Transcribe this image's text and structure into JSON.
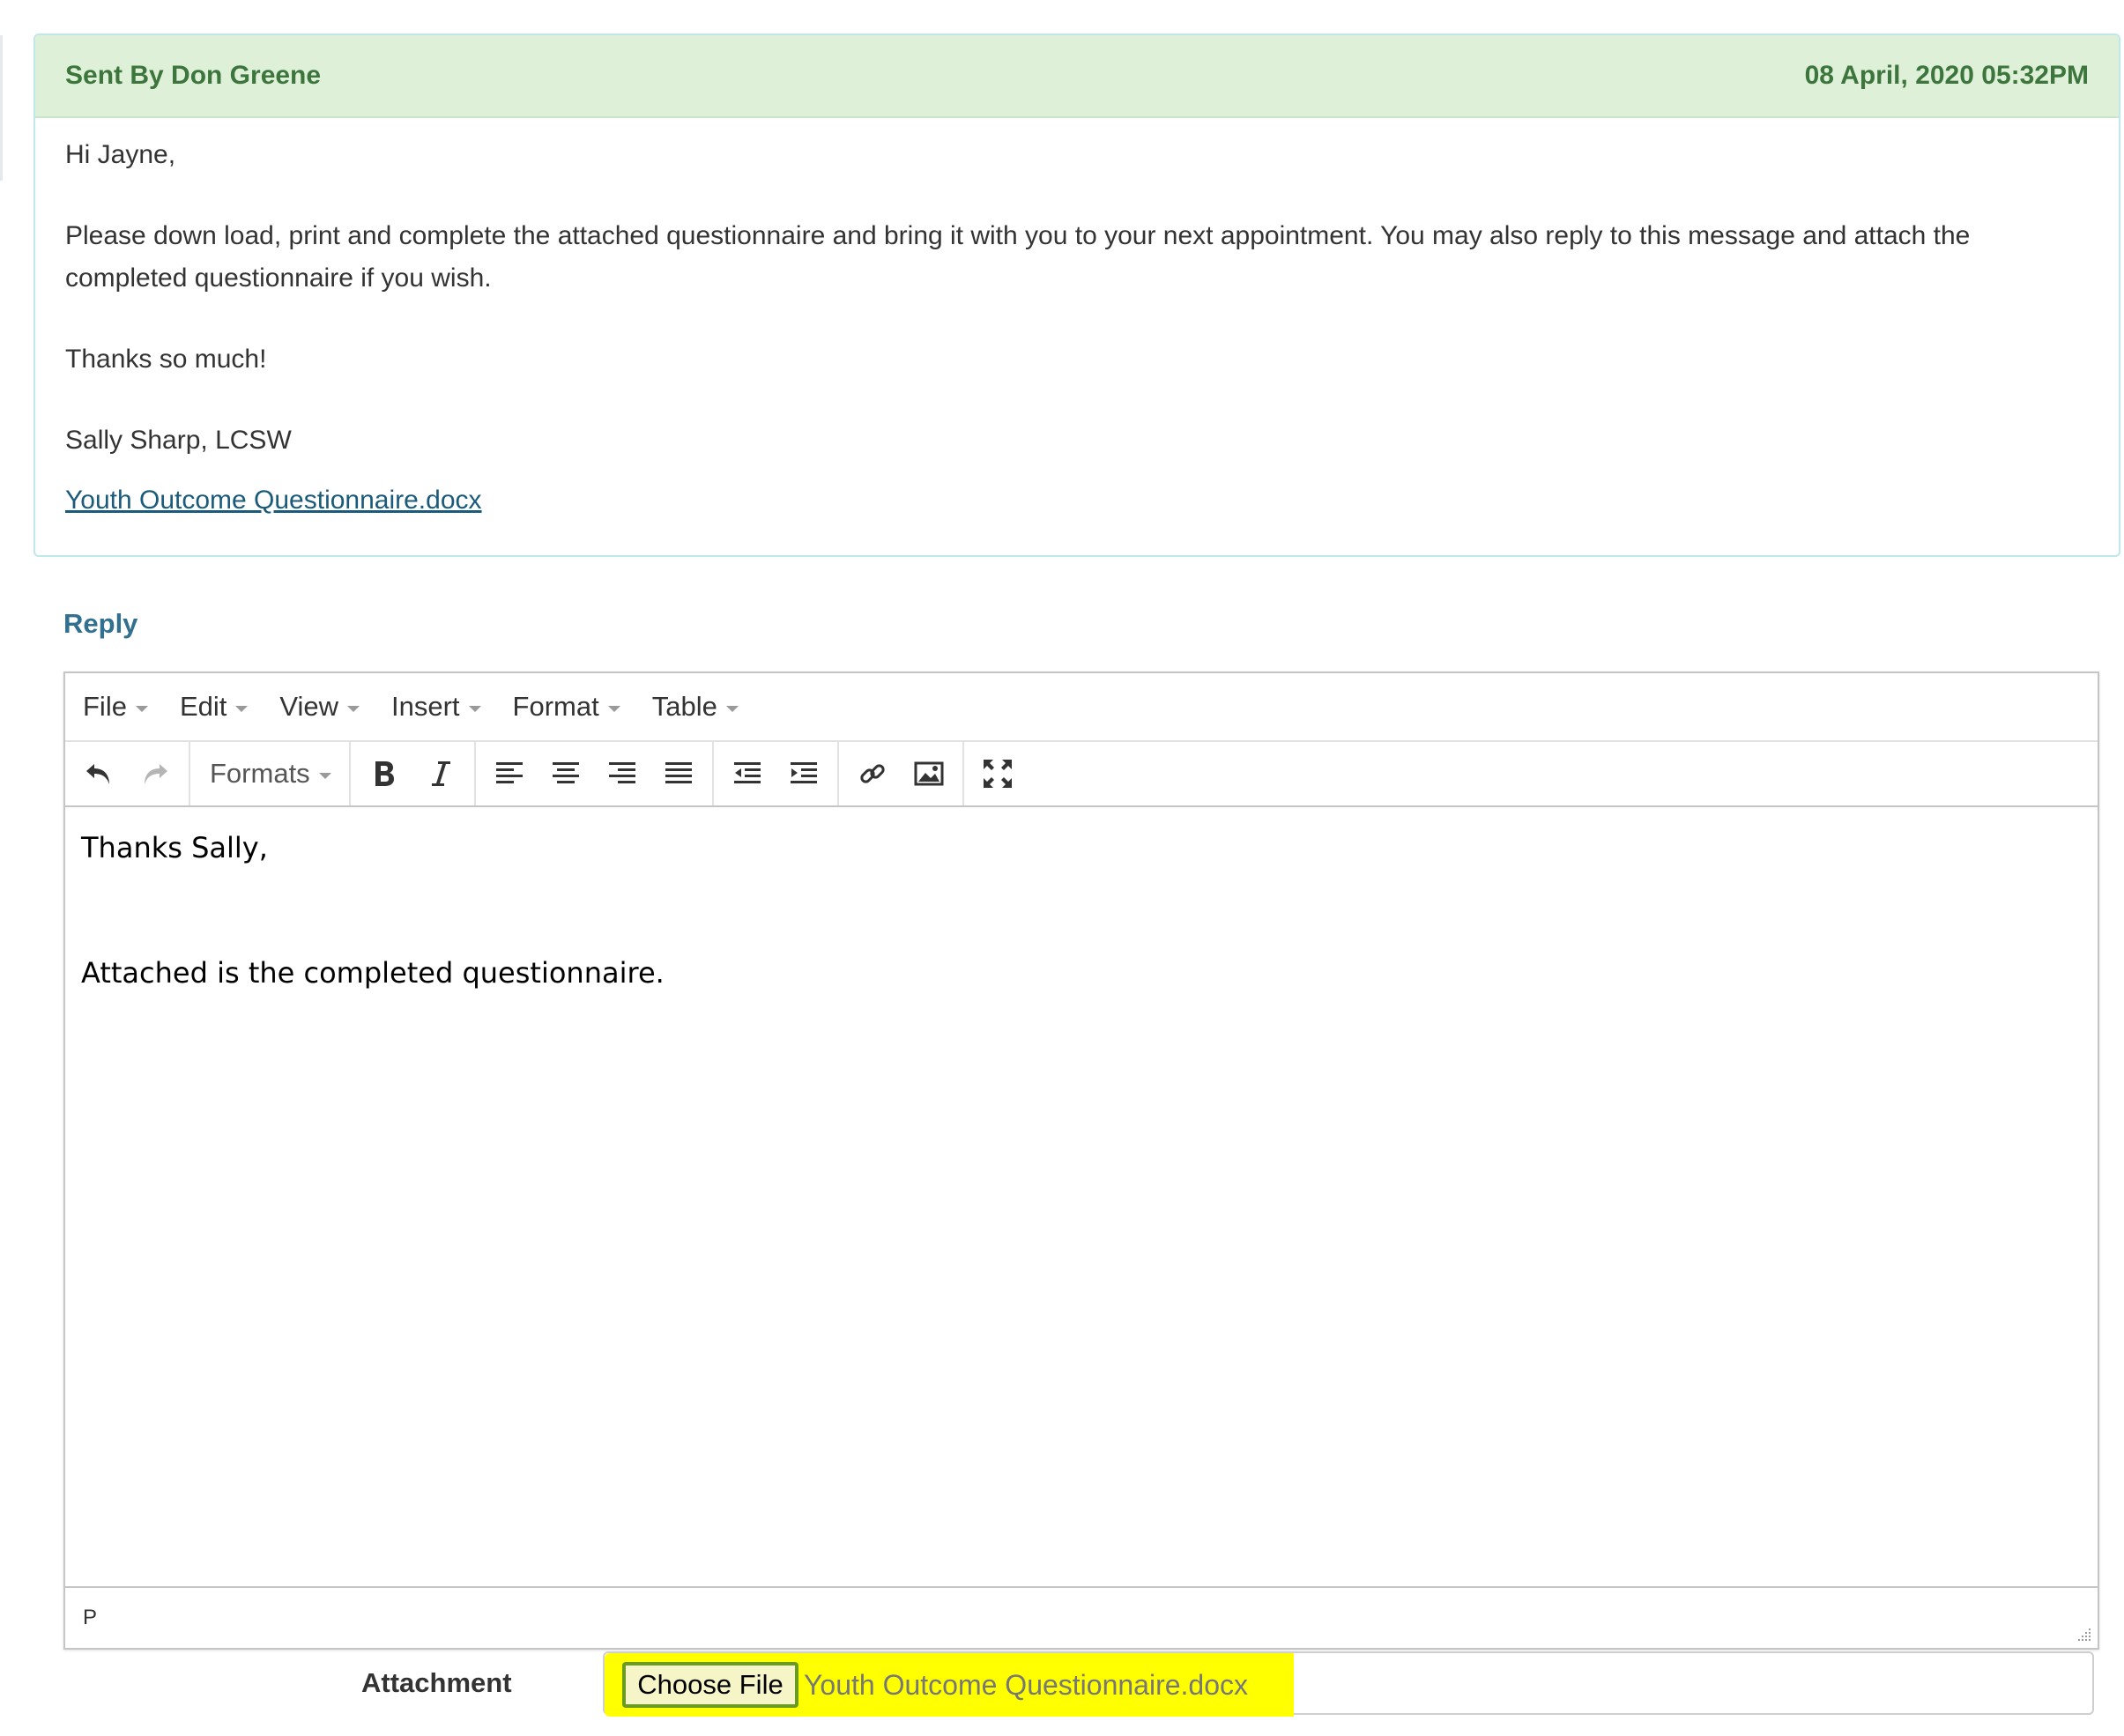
{
  "message": {
    "sender": "Sent By Don Greene",
    "date": "08 April, 2020 05:32PM",
    "greeting": "Hi Jayne,",
    "paragraph": "Please down load, print and complete the attached questionnaire and bring it with you to your next appointment. You may also reply to this message and attach the completed questionnaire if you wish.",
    "thanks": "Thanks so much!",
    "signature": "Sally Sharp, LCSW",
    "attachment_link": "Youth Outcome Questionnaire.docx"
  },
  "reply": {
    "title": "Reply",
    "menu": [
      "File",
      "Edit",
      "View",
      "Insert",
      "Format",
      "Table"
    ],
    "toolbar": {
      "formats_label": "Formats",
      "icons": [
        "undo-icon",
        "redo-icon",
        "bold-icon",
        "italic-icon",
        "align-left-icon",
        "align-center-icon",
        "align-right-icon",
        "align-justify-icon",
        "outdent-icon",
        "indent-icon",
        "link-icon",
        "image-icon",
        "fullscreen-icon"
      ]
    },
    "content": {
      "line1": "Thanks Sally,",
      "line2": "Attached is the completed questionnaire."
    },
    "status_path": "P"
  },
  "attachment": {
    "label": "Attachment",
    "button_label": "Choose File",
    "file_name": "Youth Outcome Questionnaire.docx"
  },
  "colors": {
    "header_bg": "#dff0d8",
    "header_text": "#3c763d",
    "reply_title": "#31708f",
    "link": "#1a5a7a",
    "highlight": "#ffff00"
  }
}
